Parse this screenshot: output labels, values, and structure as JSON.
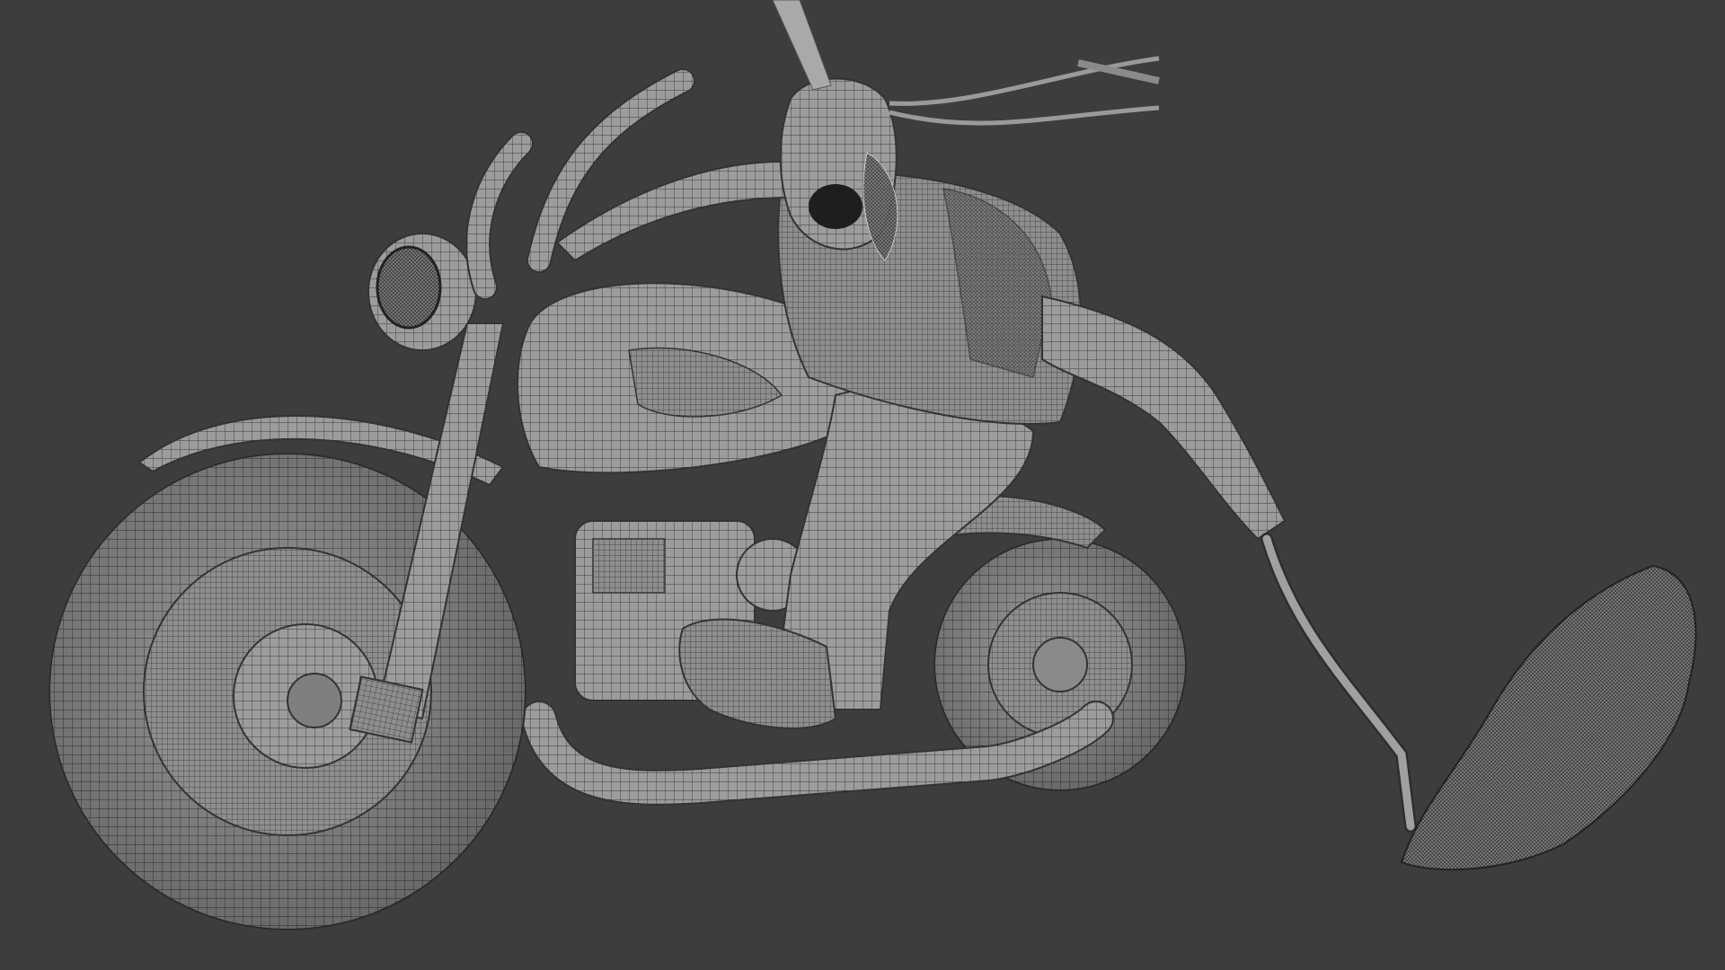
{
  "viewport": {
    "background_color": "#3d3d3d",
    "render_mode": "wireframe-on-shaded",
    "model_color": "#9a9a9a",
    "wire_color": "#2a2a2a",
    "objects": [
      "motorcycle-front-wheel",
      "motorcycle-rear-wheel",
      "motorcycle-front-fender",
      "motorcycle-fuel-tank",
      "motorcycle-headlight",
      "motorcycle-handlebars",
      "motorcycle-front-fork",
      "motorcycle-engine",
      "motorcycle-exhaust-pipe",
      "motorcycle-seat",
      "rider-body",
      "rider-head",
      "rider-vest",
      "rider-arm-left",
      "rider-arm-right",
      "rider-leg",
      "rider-boot",
      "rider-headband-ribbons",
      "rider-helmet-spike",
      "chain-weapon",
      "dragged-debris"
    ]
  }
}
